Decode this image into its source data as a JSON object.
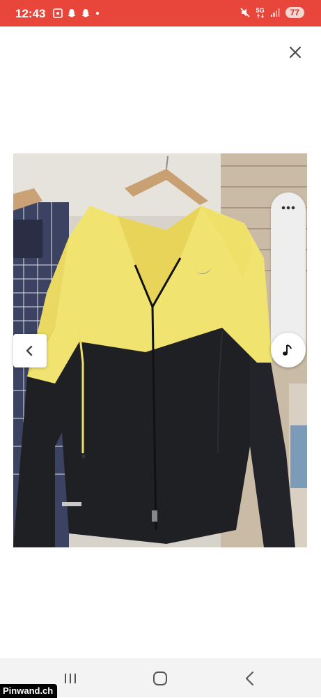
{
  "status_bar": {
    "time": "12:43",
    "network": "5G",
    "battery": "77",
    "icons": [
      "screenshot-icon",
      "snapchat-icon",
      "snapchat-icon",
      "dot-icon",
      "mute-icon",
      "signal-icon"
    ]
  },
  "colors": {
    "status_bar_bg": "#e8463a",
    "jacket_yellow": "#f1e36f",
    "jacket_black": "#1f2024"
  },
  "viewer": {
    "close_icon": "close-icon",
    "prev_icon": "chevron-left-icon",
    "more_icon": "more-dots-icon",
    "music_icon": "music-note-icon"
  },
  "navigation": {
    "buttons": [
      "recent-apps-icon",
      "home-icon",
      "back-icon"
    ]
  },
  "watermark": "Pinwand.ch"
}
